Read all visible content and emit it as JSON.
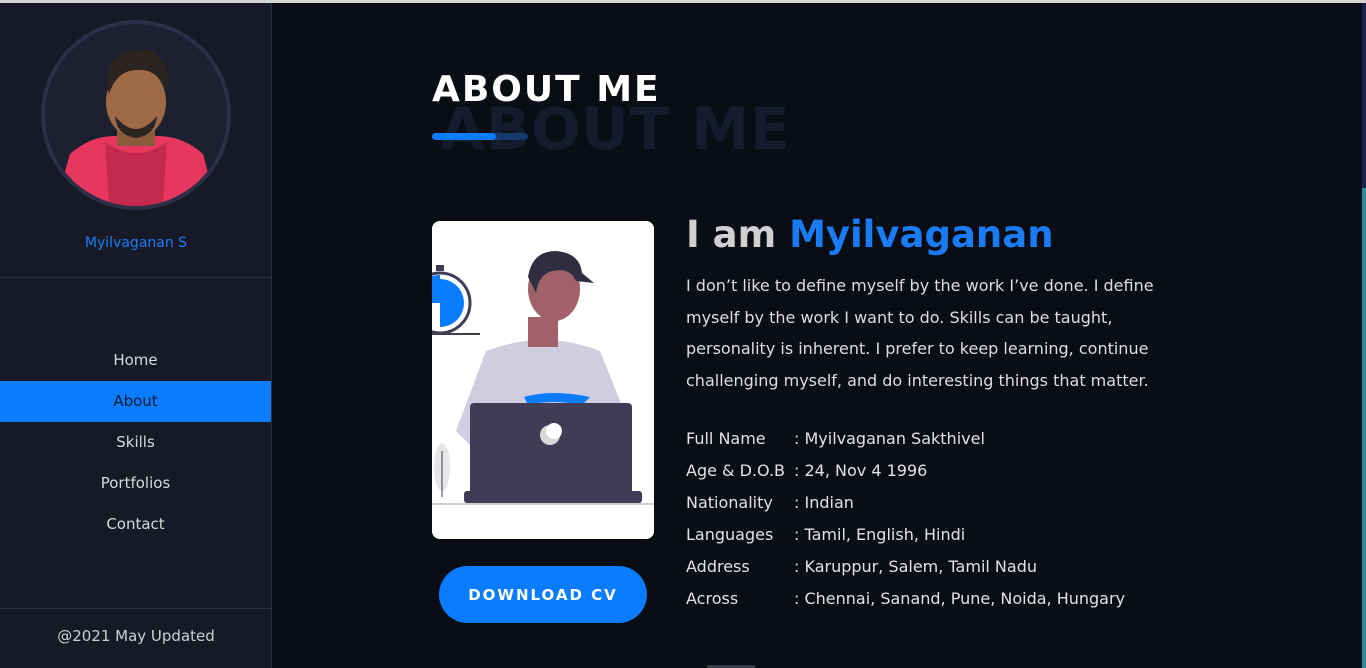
{
  "sidebar": {
    "profile_name": "Myilvaganan S",
    "nav": [
      {
        "label": "Home",
        "active": false
      },
      {
        "label": "About",
        "active": true
      },
      {
        "label": "Skills",
        "active": false
      },
      {
        "label": "Portfolios",
        "active": false
      },
      {
        "label": "Contact",
        "active": false
      }
    ],
    "footer": "@2021 May Updated"
  },
  "main": {
    "title": "ABOUT ME",
    "title_ghost": "ABOUT ME",
    "intro_prefix": "I am ",
    "intro_name": "Myilvaganan",
    "intro_text": "I don’t like to define myself by the work I’ve done. I define myself by the work I want to do. Skills can be taught, personality is inherent. I prefer to keep learning, continue challenging myself, and do interesting things that matter.",
    "download_label": "DOWNLOAD CV",
    "details": [
      {
        "key": "Full Name",
        "value": ": Myilvaganan Sakthivel"
      },
      {
        "key": "Age & D.O.B",
        "value": ": 24, Nov 4 1996"
      },
      {
        "key": "Nationality",
        "value": ": Indian"
      },
      {
        "key": "Languages",
        "value": ": Tamil, English, Hindi"
      },
      {
        "key": "Address",
        "value": ": Karuppur, Salem, Tamil Nadu"
      },
      {
        "key": "Across",
        "value": ": Chennai, Sanand, Pune, Noida, Hungary"
      }
    ]
  },
  "colors": {
    "accent": "#0a7cff",
    "background": "#0b0d15",
    "sidebar": "#171a26"
  }
}
